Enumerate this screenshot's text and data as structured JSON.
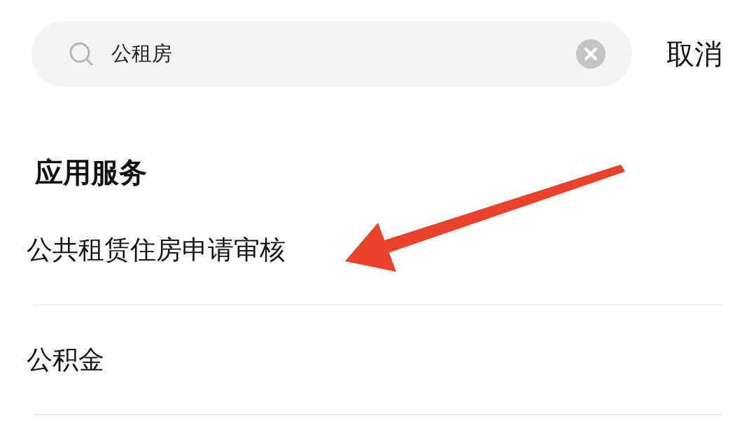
{
  "search": {
    "value": "公租房"
  },
  "cancel_button": "取消",
  "section": {
    "title": "应用服务",
    "items": [
      {
        "label": "公共租赁住房申请审核"
      },
      {
        "label": "公积金"
      }
    ]
  }
}
